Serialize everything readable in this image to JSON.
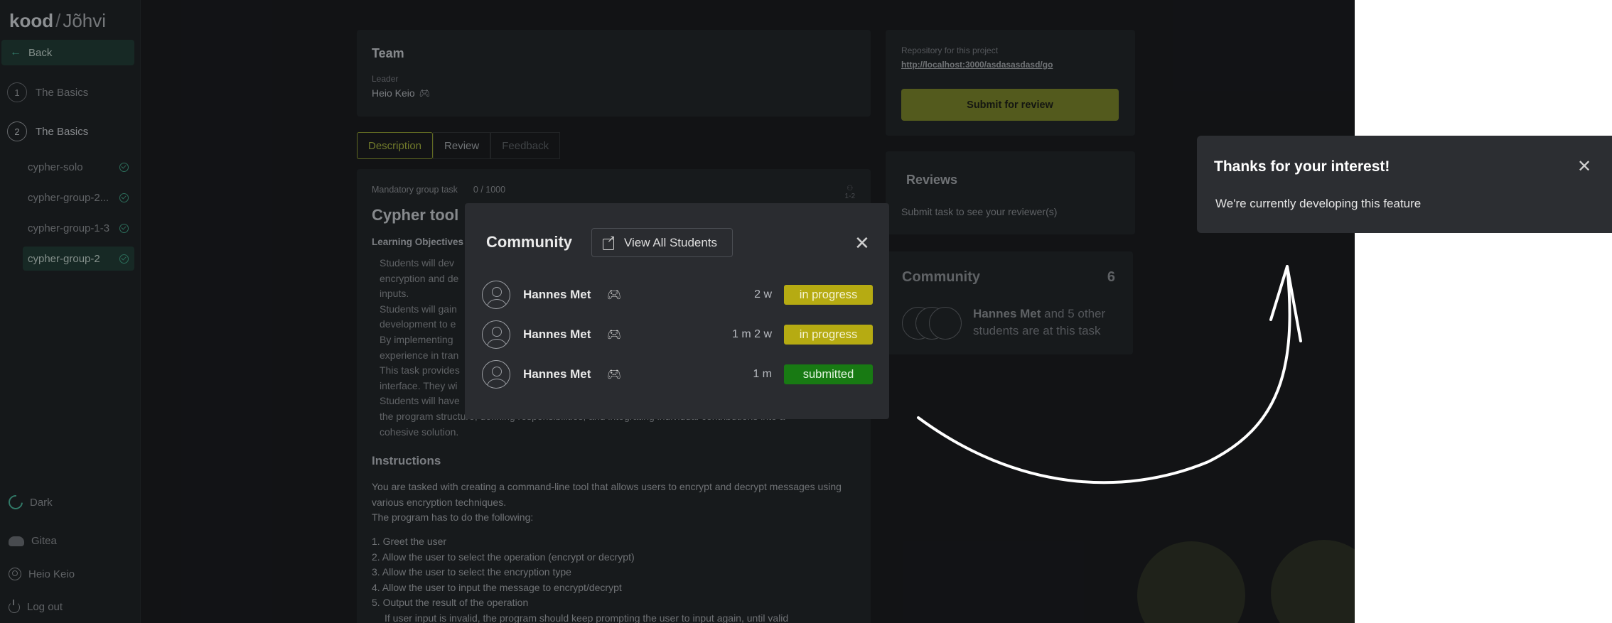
{
  "sidebar": {
    "logo_brand": "kood",
    "logo_city": "Jõhvi",
    "back_label": "Back",
    "sections": [
      {
        "num": "1",
        "label": "The Basics"
      },
      {
        "num": "2",
        "label": "The Basics"
      }
    ],
    "tasks": [
      "cypher-solo",
      "cypher-group-2...",
      "cypher-group-1-3",
      "cypher-group-2"
    ],
    "theme_label": "Dark",
    "gitea_label": "Gitea",
    "user_label": "Heio Keio",
    "logout_label": "Log out"
  },
  "team": {
    "title": "Team",
    "leader_label": "Leader",
    "leader_name": "Heio Keio"
  },
  "tabs": [
    "Description",
    "Review",
    "Feedback"
  ],
  "description": {
    "task_type": "Mandatory group task",
    "score": "0 / 1000",
    "size": "1-2",
    "title": "Cypher tool",
    "learning_objectives": "Learning Objectives",
    "lines": [
      "Students will dev",
      "encryption and de",
      "inputs.",
      "Students will gain",
      "development to e",
      "By implementing",
      "experience in tran",
      "This task provides",
      "interface. They wi",
      "Students will have",
      "the program structure, defining responsibilities, and integrating individual contributions into a",
      "cohesive solution."
    ],
    "instructions_title": "Instructions",
    "instructions_intro": "You are tasked with creating a command-line tool that allows users to encrypt and decrypt messages using various encryption techniques.",
    "instructions_lead": "The program has to do the following:",
    "steps": [
      "1. Greet the user",
      "2. Allow the user to select the operation (encrypt or decrypt)",
      "3. Allow the user to select the encryption type",
      "4. Allow the user to input the message to encrypt/decrypt",
      "5. Output the result of the operation",
      "If user input is invalid, the program should keep prompting the user to input again, until valid"
    ]
  },
  "repo": {
    "label": "Repository for this project",
    "url": "http://localhost:3000/asdasasdasd/go",
    "submit_label": "Submit for review"
  },
  "reviews": {
    "title": "Reviews",
    "subtitle": "Submit task to see your reviewer(s)"
  },
  "community_card": {
    "title": "Community",
    "count": "6",
    "highlight_name": "Hannes Met",
    "text": " and 5 other students are at this task"
  },
  "modal": {
    "title": "Community",
    "view_all_label": "View All Students",
    "rows": [
      {
        "name": "Hannes Met",
        "time": "2 w",
        "status": "in progress",
        "status_type": "progress"
      },
      {
        "name": "Hannes Met",
        "time": "1 m 2 w",
        "status": "in progress",
        "status_type": "progress"
      },
      {
        "name": "Hannes Met",
        "time": "1 m",
        "status": "submitted",
        "status_type": "submitted"
      }
    ]
  },
  "toast": {
    "title": "Thanks for your interest!",
    "message": "We're currently developing this feature"
  },
  "colors": {
    "accent_green": "#48b59a",
    "olive": "#7c8527",
    "progress": "#b6ab12",
    "submitted": "#187a13"
  }
}
